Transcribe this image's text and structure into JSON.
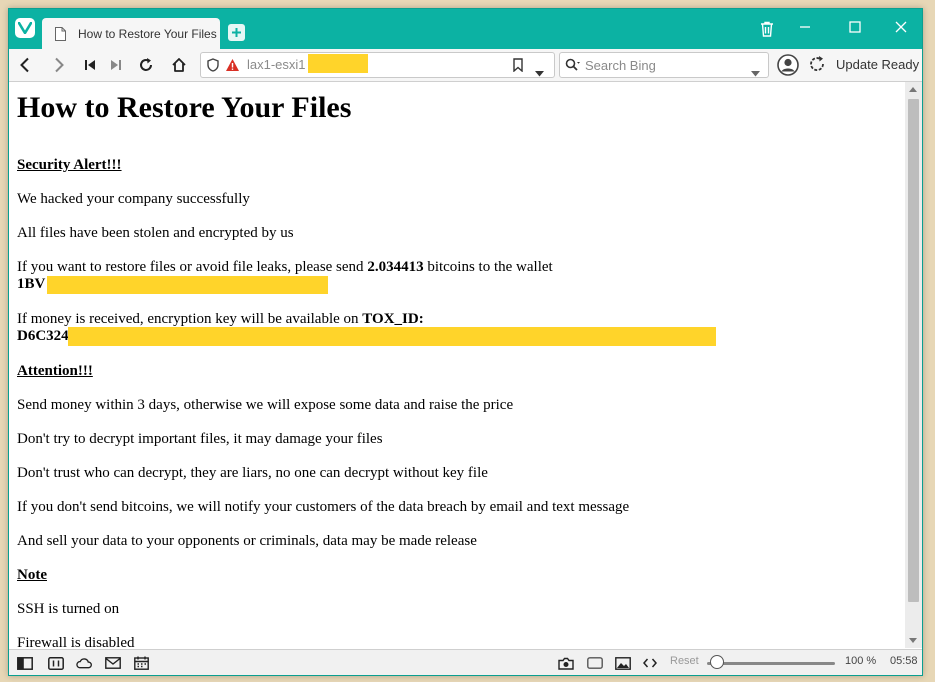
{
  "browser": {
    "tab_title": "How to Restore Your Files",
    "url": "lax1-esxi1",
    "search_placeholder": "Search Bing",
    "update_label": "Update Ready",
    "accent_color": "#0cb2a3",
    "redaction_color": "#ffd42a"
  },
  "statusbar": {
    "reset_label": "Reset",
    "zoom_percent": 100,
    "zoom_label": "100 %",
    "clock": "05:58"
  },
  "page": {
    "title": "How to Restore Your Files",
    "security_alert": "Security Alert!!!",
    "hacked": "We hacked your company successfully",
    "stolen": "All files have been stolen and encrypted by us",
    "restore_prefix": "If you want to restore files or avoid file leaks, please send ",
    "btc_amount": "2.034413",
    "restore_suffix": " bitcoins to the wallet",
    "wallet_visible": "1BV",
    "money_prefix": "If money is received, encryption key will be available on ",
    "tox_label": "TOX_ID:",
    "tox_visible": "D6C324",
    "attention": "Attention!!!",
    "instructions": [
      "Send money within 3 days, otherwise we will expose some data and raise the price",
      "Don't try to decrypt important files, it may damage your files",
      "Don't trust who can decrypt, they are liars, no one can decrypt without key file",
      "If you don't send bitcoins, we will notify your customers of the data breach by email and text message",
      "And sell your data to your opponents or criminals, data may be made release"
    ],
    "note": "Note",
    "notes": [
      "SSH is turned on",
      "Firewall is disabled"
    ]
  }
}
